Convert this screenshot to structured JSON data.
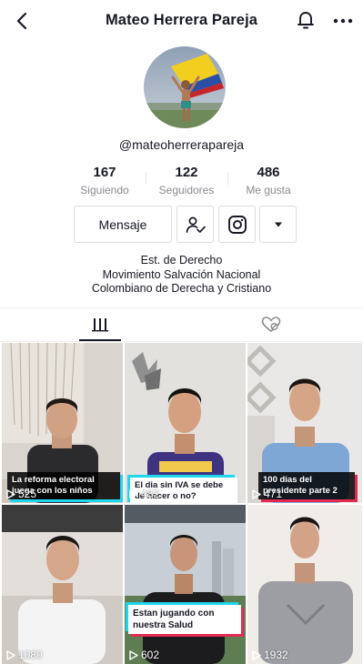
{
  "header": {
    "title": "Mateo Herrera Pareja",
    "back_icon": "chevron-left-icon",
    "bell_icon": "bell-icon",
    "more_icon": "more-dots-icon"
  },
  "profile": {
    "handle": "@mateoherrerapareja",
    "stats": [
      {
        "value": "167",
        "label": "Siguiendo"
      },
      {
        "value": "122",
        "label": "Seguidores"
      },
      {
        "value": "486",
        "label": "Me gusta"
      }
    ],
    "actions": {
      "message_label": "Mensaje",
      "follow_icon": "user-check-icon",
      "instagram_icon": "instagram-icon",
      "dropdown_icon": "caret-down-icon"
    },
    "bio": [
      "Est. de Derecho",
      "Movimiento Salvación Nacional",
      "Colombiano de Derecha y Cristiano"
    ]
  },
  "tabs": [
    {
      "name": "videos",
      "icon": "grid-icon",
      "active": true
    },
    {
      "name": "liked",
      "icon": "hidden-heart-icon",
      "active": false
    }
  ],
  "videos": [
    {
      "caption": "La reforma electoral juega con los niños",
      "views": "525"
    },
    {
      "caption": "El dia sin IVA se debe de hacer o no?",
      "views": "482"
    },
    {
      "caption": "100 dias del presidente parte 2",
      "views": "471"
    },
    {
      "caption": "",
      "views": "1080"
    },
    {
      "caption": "Estan jugando con nuestra Salud",
      "views": "602"
    },
    {
      "caption": "",
      "views": "1932"
    }
  ],
  "colors": {
    "text": "#161823",
    "secondary": "#8a8b91",
    "border": "#dcdcdf",
    "caption_accent": "#20d5ec"
  }
}
